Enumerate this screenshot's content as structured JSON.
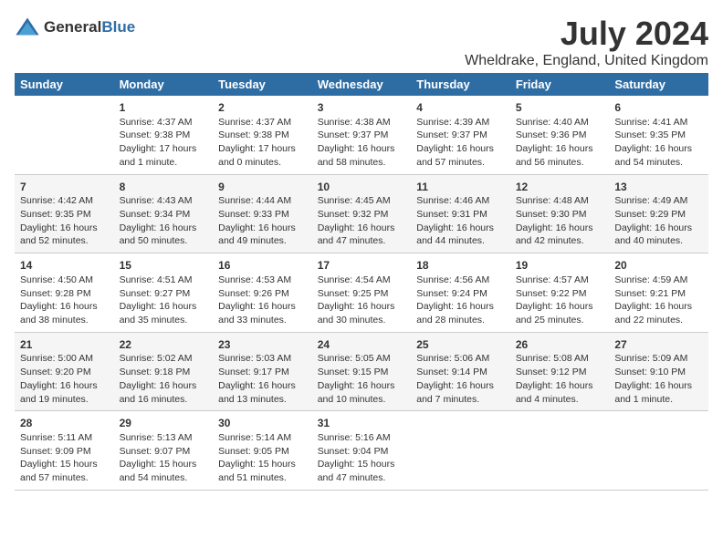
{
  "logo": {
    "general": "General",
    "blue": "Blue"
  },
  "title": "July 2024",
  "subtitle": "Wheldrake, England, United Kingdom",
  "headers": [
    "Sunday",
    "Monday",
    "Tuesday",
    "Wednesday",
    "Thursday",
    "Friday",
    "Saturday"
  ],
  "weeks": [
    [
      {
        "day": "",
        "sunrise": "",
        "sunset": "",
        "daylight": ""
      },
      {
        "day": "1",
        "sunrise": "Sunrise: 4:37 AM",
        "sunset": "Sunset: 9:38 PM",
        "daylight": "Daylight: 17 hours and 1 minute."
      },
      {
        "day": "2",
        "sunrise": "Sunrise: 4:37 AM",
        "sunset": "Sunset: 9:38 PM",
        "daylight": "Daylight: 17 hours and 0 minutes."
      },
      {
        "day": "3",
        "sunrise": "Sunrise: 4:38 AM",
        "sunset": "Sunset: 9:37 PM",
        "daylight": "Daylight: 16 hours and 58 minutes."
      },
      {
        "day": "4",
        "sunrise": "Sunrise: 4:39 AM",
        "sunset": "Sunset: 9:37 PM",
        "daylight": "Daylight: 16 hours and 57 minutes."
      },
      {
        "day": "5",
        "sunrise": "Sunrise: 4:40 AM",
        "sunset": "Sunset: 9:36 PM",
        "daylight": "Daylight: 16 hours and 56 minutes."
      },
      {
        "day": "6",
        "sunrise": "Sunrise: 4:41 AM",
        "sunset": "Sunset: 9:35 PM",
        "daylight": "Daylight: 16 hours and 54 minutes."
      }
    ],
    [
      {
        "day": "7",
        "sunrise": "Sunrise: 4:42 AM",
        "sunset": "Sunset: 9:35 PM",
        "daylight": "Daylight: 16 hours and 52 minutes."
      },
      {
        "day": "8",
        "sunrise": "Sunrise: 4:43 AM",
        "sunset": "Sunset: 9:34 PM",
        "daylight": "Daylight: 16 hours and 50 minutes."
      },
      {
        "day": "9",
        "sunrise": "Sunrise: 4:44 AM",
        "sunset": "Sunset: 9:33 PM",
        "daylight": "Daylight: 16 hours and 49 minutes."
      },
      {
        "day": "10",
        "sunrise": "Sunrise: 4:45 AM",
        "sunset": "Sunset: 9:32 PM",
        "daylight": "Daylight: 16 hours and 47 minutes."
      },
      {
        "day": "11",
        "sunrise": "Sunrise: 4:46 AM",
        "sunset": "Sunset: 9:31 PM",
        "daylight": "Daylight: 16 hours and 44 minutes."
      },
      {
        "day": "12",
        "sunrise": "Sunrise: 4:48 AM",
        "sunset": "Sunset: 9:30 PM",
        "daylight": "Daylight: 16 hours and 42 minutes."
      },
      {
        "day": "13",
        "sunrise": "Sunrise: 4:49 AM",
        "sunset": "Sunset: 9:29 PM",
        "daylight": "Daylight: 16 hours and 40 minutes."
      }
    ],
    [
      {
        "day": "14",
        "sunrise": "Sunrise: 4:50 AM",
        "sunset": "Sunset: 9:28 PM",
        "daylight": "Daylight: 16 hours and 38 minutes."
      },
      {
        "day": "15",
        "sunrise": "Sunrise: 4:51 AM",
        "sunset": "Sunset: 9:27 PM",
        "daylight": "Daylight: 16 hours and 35 minutes."
      },
      {
        "day": "16",
        "sunrise": "Sunrise: 4:53 AM",
        "sunset": "Sunset: 9:26 PM",
        "daylight": "Daylight: 16 hours and 33 minutes."
      },
      {
        "day": "17",
        "sunrise": "Sunrise: 4:54 AM",
        "sunset": "Sunset: 9:25 PM",
        "daylight": "Daylight: 16 hours and 30 minutes."
      },
      {
        "day": "18",
        "sunrise": "Sunrise: 4:56 AM",
        "sunset": "Sunset: 9:24 PM",
        "daylight": "Daylight: 16 hours and 28 minutes."
      },
      {
        "day": "19",
        "sunrise": "Sunrise: 4:57 AM",
        "sunset": "Sunset: 9:22 PM",
        "daylight": "Daylight: 16 hours and 25 minutes."
      },
      {
        "day": "20",
        "sunrise": "Sunrise: 4:59 AM",
        "sunset": "Sunset: 9:21 PM",
        "daylight": "Daylight: 16 hours and 22 minutes."
      }
    ],
    [
      {
        "day": "21",
        "sunrise": "Sunrise: 5:00 AM",
        "sunset": "Sunset: 9:20 PM",
        "daylight": "Daylight: 16 hours and 19 minutes."
      },
      {
        "day": "22",
        "sunrise": "Sunrise: 5:02 AM",
        "sunset": "Sunset: 9:18 PM",
        "daylight": "Daylight: 16 hours and 16 minutes."
      },
      {
        "day": "23",
        "sunrise": "Sunrise: 5:03 AM",
        "sunset": "Sunset: 9:17 PM",
        "daylight": "Daylight: 16 hours and 13 minutes."
      },
      {
        "day": "24",
        "sunrise": "Sunrise: 5:05 AM",
        "sunset": "Sunset: 9:15 PM",
        "daylight": "Daylight: 16 hours and 10 minutes."
      },
      {
        "day": "25",
        "sunrise": "Sunrise: 5:06 AM",
        "sunset": "Sunset: 9:14 PM",
        "daylight": "Daylight: 16 hours and 7 minutes."
      },
      {
        "day": "26",
        "sunrise": "Sunrise: 5:08 AM",
        "sunset": "Sunset: 9:12 PM",
        "daylight": "Daylight: 16 hours and 4 minutes."
      },
      {
        "day": "27",
        "sunrise": "Sunrise: 5:09 AM",
        "sunset": "Sunset: 9:10 PM",
        "daylight": "Daylight: 16 hours and 1 minute."
      }
    ],
    [
      {
        "day": "28",
        "sunrise": "Sunrise: 5:11 AM",
        "sunset": "Sunset: 9:09 PM",
        "daylight": "Daylight: 15 hours and 57 minutes."
      },
      {
        "day": "29",
        "sunrise": "Sunrise: 5:13 AM",
        "sunset": "Sunset: 9:07 PM",
        "daylight": "Daylight: 15 hours and 54 minutes."
      },
      {
        "day": "30",
        "sunrise": "Sunrise: 5:14 AM",
        "sunset": "Sunset: 9:05 PM",
        "daylight": "Daylight: 15 hours and 51 minutes."
      },
      {
        "day": "31",
        "sunrise": "Sunrise: 5:16 AM",
        "sunset": "Sunset: 9:04 PM",
        "daylight": "Daylight: 15 hours and 47 minutes."
      },
      {
        "day": "",
        "sunrise": "",
        "sunset": "",
        "daylight": ""
      },
      {
        "day": "",
        "sunrise": "",
        "sunset": "",
        "daylight": ""
      },
      {
        "day": "",
        "sunrise": "",
        "sunset": "",
        "daylight": ""
      }
    ]
  ]
}
